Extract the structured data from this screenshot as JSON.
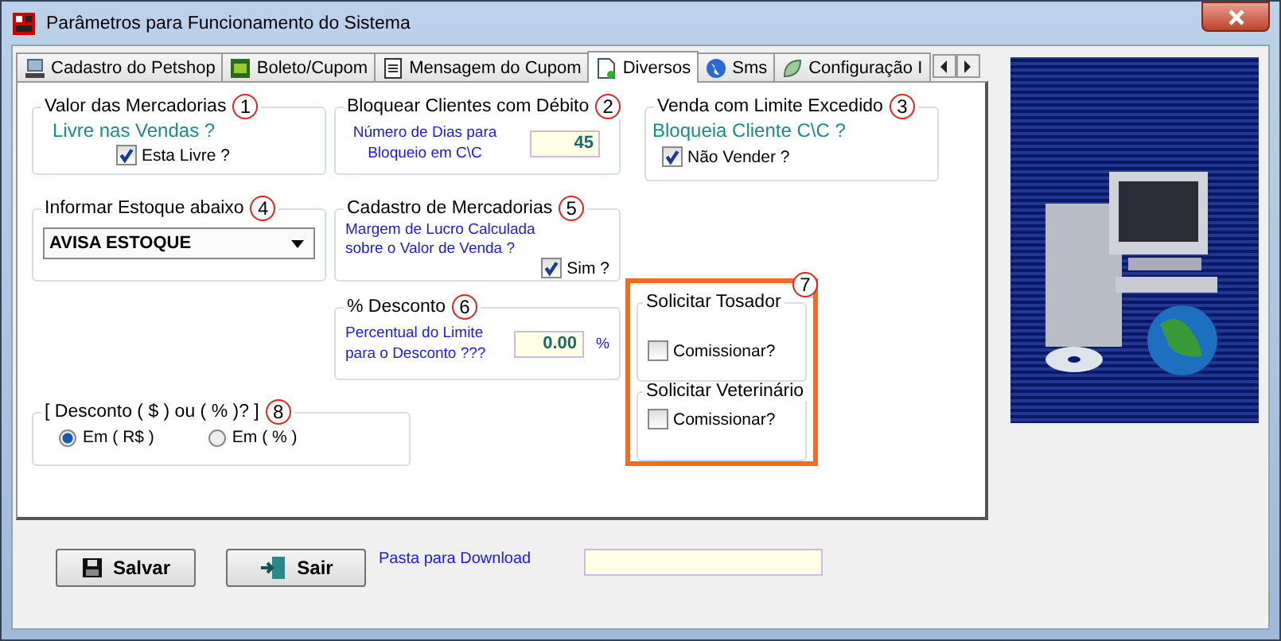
{
  "window": {
    "title": "Parâmetros para Funcionamento do Sistema"
  },
  "tabs": [
    {
      "label": "Cadastro do Petshop",
      "selected": false,
      "kind": "monitor"
    },
    {
      "label": "Boleto/Cupom",
      "selected": false,
      "kind": "board"
    },
    {
      "label": "Mensagem do Cupom",
      "selected": false,
      "kind": "note"
    },
    {
      "label": "Diversos",
      "selected": true,
      "kind": "page"
    },
    {
      "label": "Sms",
      "selected": false,
      "kind": "globe"
    },
    {
      "label": "Configuração I",
      "selected": false,
      "kind": "leaf"
    }
  ],
  "valor_mercadorias": {
    "title": "Valor das Mercadorias",
    "number": "1",
    "question": "Livre nas Vendas ?",
    "checkbox": {
      "label": "Esta Livre ?",
      "checked": true
    }
  },
  "bloquear_clientes": {
    "title": "Bloquear Clientes com Débito",
    "number": "2",
    "label": "Número de Dias para Bloqueio em C\\C",
    "value": "45"
  },
  "venda_limite": {
    "title": "Venda com Limite Excedido",
    "number": "3",
    "question": "Bloqueia Cliente C\\C ?",
    "checkbox": {
      "label": "Não Vender ?",
      "checked": true
    }
  },
  "informar_estoque": {
    "title": "Informar Estoque abaixo",
    "number": "4",
    "value": "AVISA ESTOQUE"
  },
  "cadastro_mercadorias": {
    "title": "Cadastro de Mercadorias",
    "number": "5",
    "label": "Margem de Lucro Calculada sobre o Valor de Venda ?",
    "checkbox": {
      "label": "Sim ?",
      "checked": true
    }
  },
  "desconto": {
    "title": "% Desconto",
    "number": "6",
    "label": "Percentual do Limite para o Desconto ???",
    "value": "0.00",
    "unit": "%"
  },
  "solicitar": {
    "number": "7",
    "groups": [
      {
        "title": "Solicitar Tosador",
        "checkbox": {
          "label": "Comissionar?",
          "checked": false
        }
      },
      {
        "title": "Solicitar Veterinário",
        "checkbox": {
          "label": "Comissionar?",
          "checked": false
        }
      }
    ]
  },
  "tipo_desconto": {
    "title": "[ Desconto ( $ ) ou ( % )? ]",
    "number": "8",
    "options": [
      {
        "label": "Em ( R$ )",
        "selected": true
      },
      {
        "label": "Em ( % )",
        "selected": false
      }
    ]
  },
  "buttons": [
    {
      "label": "Salvar",
      "kind": "save"
    },
    {
      "label": "Sair",
      "kind": "exit"
    }
  ],
  "download": {
    "label": "Pasta para Download"
  }
}
